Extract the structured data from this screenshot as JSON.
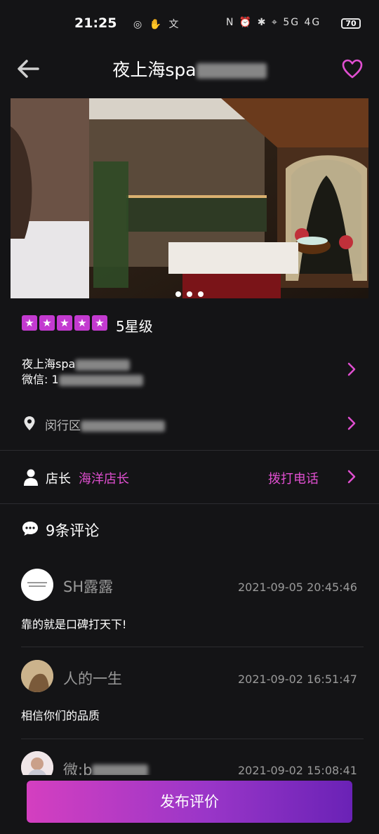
{
  "status_bar": {
    "time": "21:25",
    "left_icons": "◎ ✋ 文",
    "right_icons": "N ⏰ ✱ ⌖ 5G 4G",
    "battery": "70"
  },
  "header": {
    "title_prefix": "夜上海spa",
    "back_icon": "arrow-left-icon",
    "favorite_icon": "heart-icon"
  },
  "banner": {
    "page_count": 3
  },
  "rating": {
    "stars": 5,
    "label": "5星级"
  },
  "shop": {
    "name_prefix": "夜上海spa",
    "wechat_prefix": "微信: 1",
    "location_prefix": "闵行区"
  },
  "manager": {
    "label": "店长",
    "name": "海洋店长",
    "call_label": "拨打电话"
  },
  "comments": {
    "title": "9条评论",
    "items": [
      {
        "user": "SH露露",
        "time": "2021-09-05 20:45:46",
        "text": "靠的就是口碑打天下!"
      },
      {
        "user": "人的一生",
        "time": "2021-09-02 16:51:47",
        "text": "相信你们的品质"
      },
      {
        "user": "微:b",
        "time": "2021-09-02 15:08:41",
        "text": ""
      }
    ]
  },
  "actions": {
    "publish_label": "发布评价"
  },
  "colors": {
    "accent": "#e04fd0",
    "background": "#141416",
    "button_start": "#d43fc0",
    "button_end": "#6a22b6"
  }
}
